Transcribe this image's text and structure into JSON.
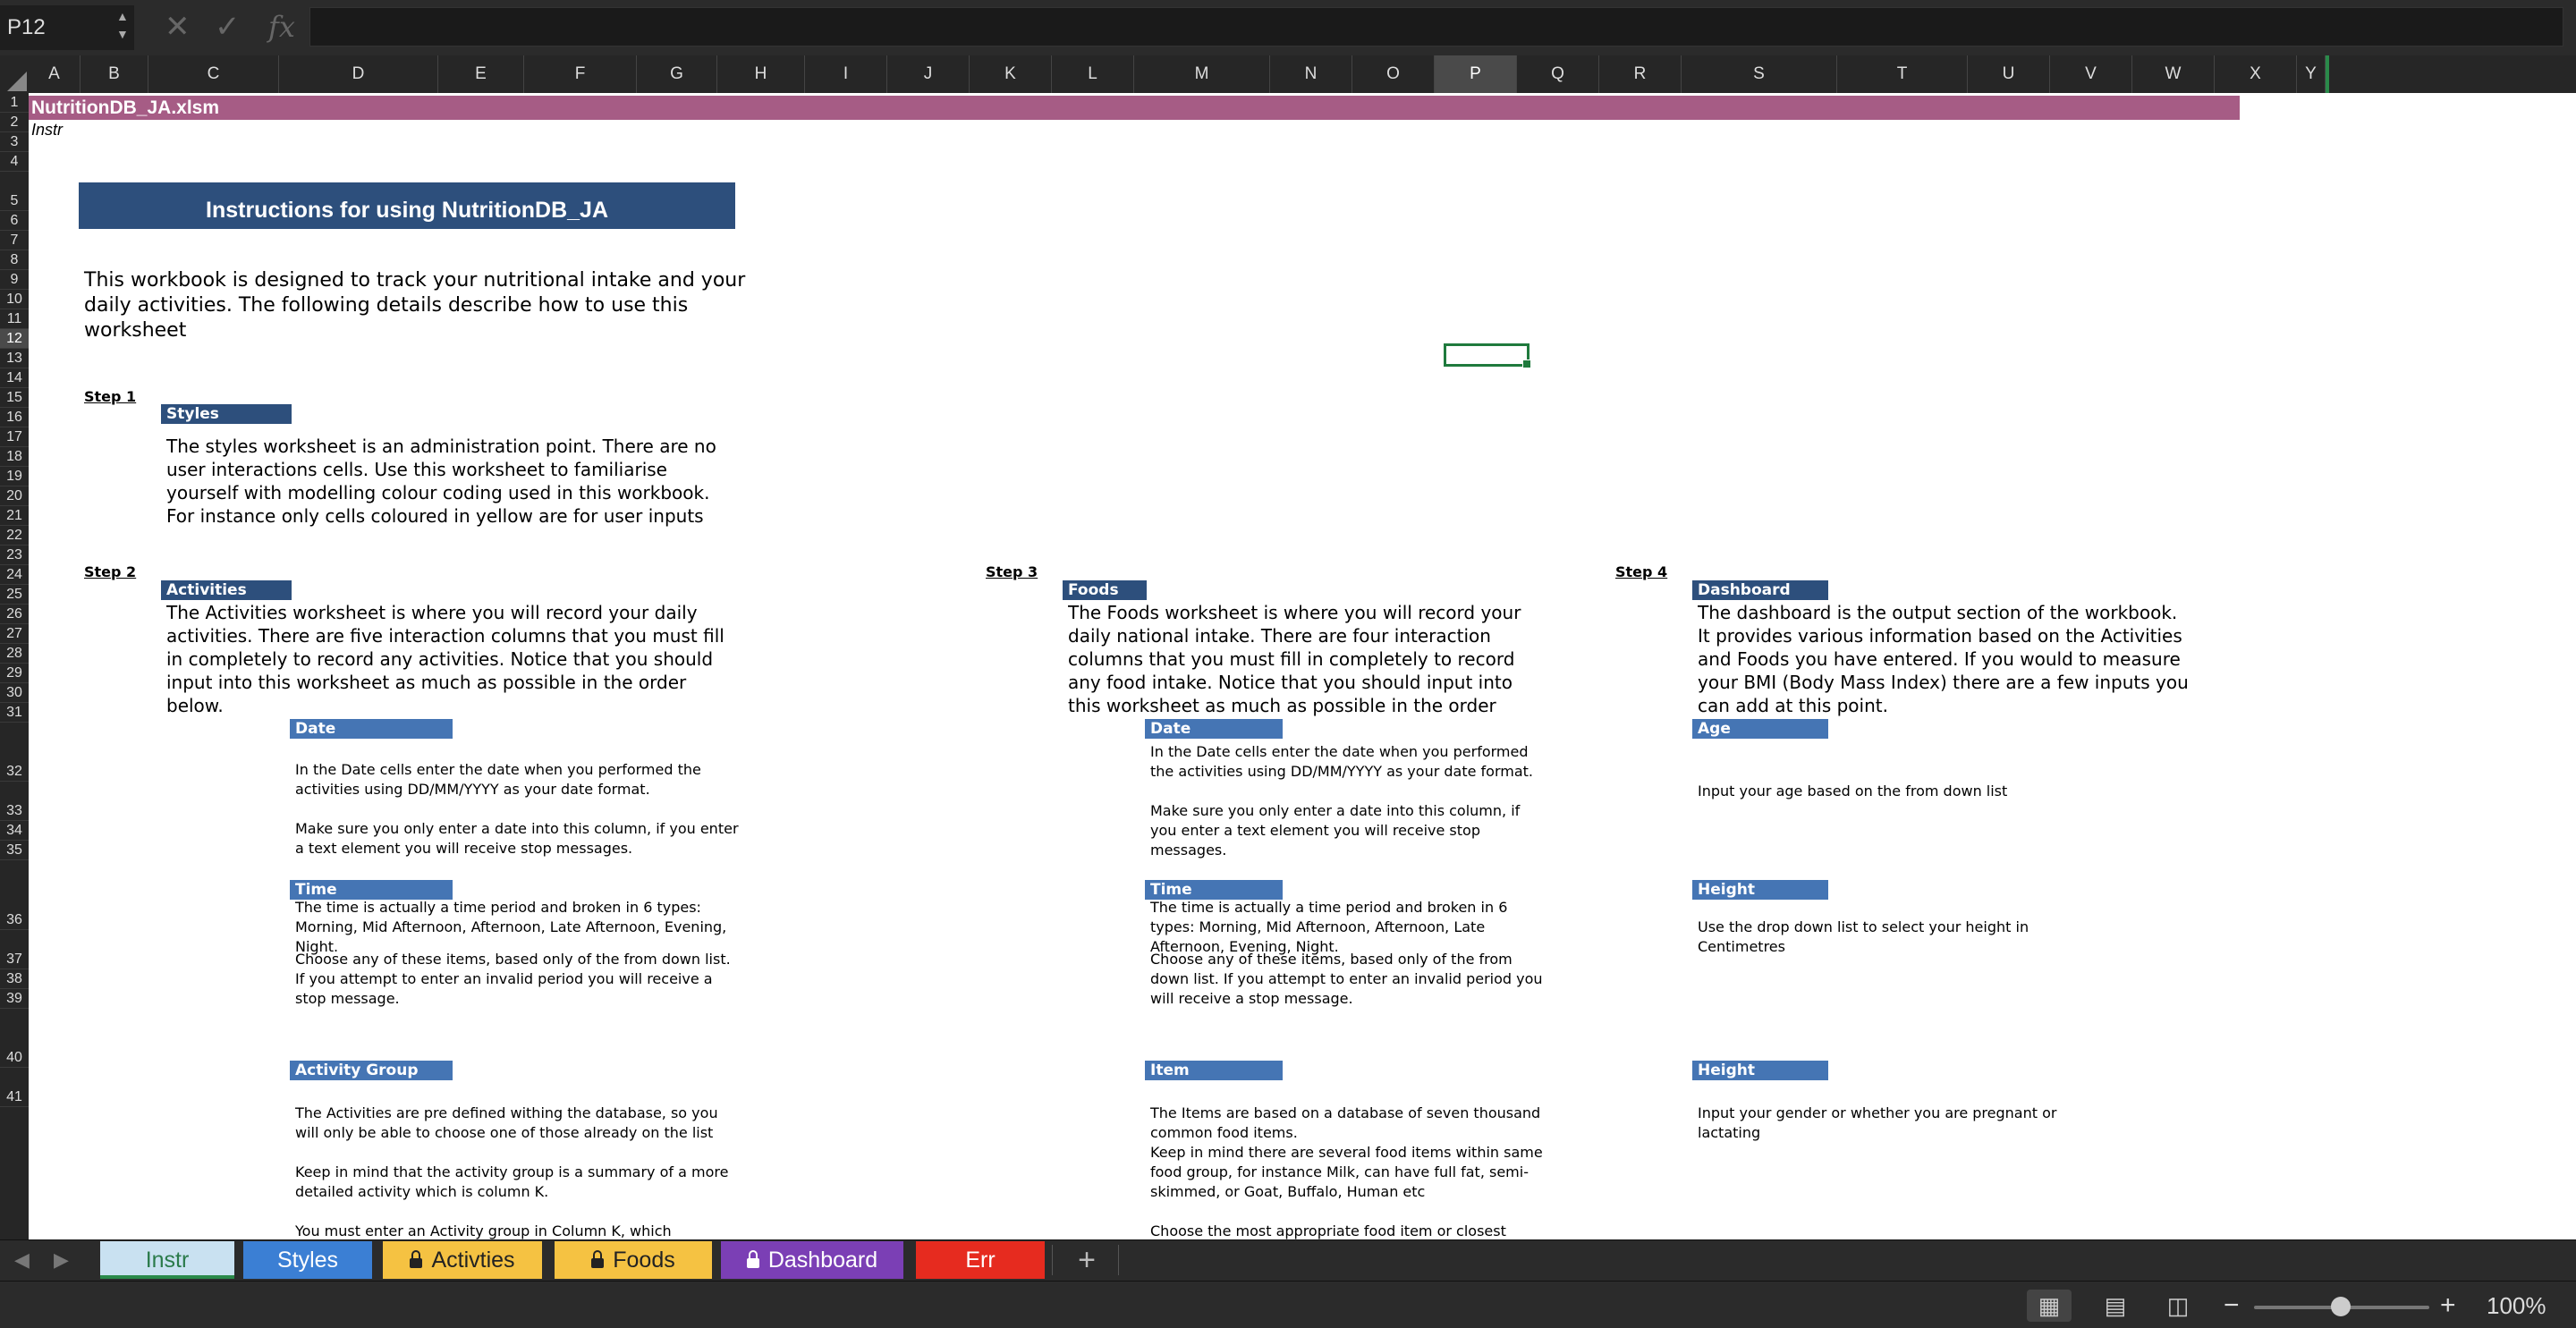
{
  "formula_bar": {
    "name_box": "P12",
    "cancel_icon": "✕",
    "enter_icon": "✓",
    "fx_label": "fx",
    "formula": ""
  },
  "columns": [
    "A",
    "B",
    "C",
    "D",
    "E",
    "F",
    "G",
    "H",
    "I",
    "J",
    "K",
    "L",
    "M",
    "N",
    "O",
    "P",
    "Q",
    "R",
    "S",
    "T",
    "U",
    "V",
    "W",
    "X",
    "Y"
  ],
  "selected_column": "P",
  "selected_row": "12",
  "rows": [
    "1",
    "2",
    "3",
    "4",
    "5",
    "6",
    "7",
    "8",
    "9",
    "10",
    "11",
    "12",
    "13",
    "14",
    "15",
    "16",
    "17",
    "18",
    "19",
    "20",
    "21",
    "22",
    "23",
    "24",
    "25",
    "26",
    "27",
    "28",
    "29",
    "30",
    "31",
    "32",
    "33",
    "34",
    "35",
    "36",
    "37",
    "38",
    "39",
    "40",
    "41"
  ],
  "sheet": {
    "title": "NutritionDB_JA.xlsm",
    "sheet_name": "Instr",
    "header": "Instructions for using NutritionDB_JA",
    "intro": "This workbook is designed to track your nutritional intake and your daily activities. The following details describe how to use this worksheet",
    "step1": {
      "label": "Step 1",
      "tag": "Styles",
      "text": "The styles worksheet is an administration point. There are no user interactions cells. Use this worksheet to familiarise yourself with modelling colour coding used in this workbook. For instance only cells coloured in yellow are for user inputs"
    },
    "step2": {
      "label": "Step 2",
      "tag": "Activities",
      "text": "The Activities worksheet is where you will record your daily activities. There are five interaction columns that you must fill in completely to record any activities. Notice that you should input into this worksheet as much as possible in the order below.",
      "date_tag": "Date",
      "date_text1": "In the Date cells enter the date when you performed the activities using DD/MM/YYYY as your date format.",
      "date_text2": "Make sure you only enter a date into this column, if you enter a text element you will receive stop messages.",
      "time_tag": "Time",
      "time_text1": "The time is actually a time period and broken in 6 types: Morning, Mid Afternoon, Afternoon, Late Afternoon, Evening, Night.",
      "time_text2": "Choose any of these items, based only of the from down list. If you attempt to enter an invalid period you will receive a stop message.",
      "group_tag": "Activity Group",
      "group_text1": "The Activities are pre defined withing the database, so you will only be able to choose one of those already on the list",
      "group_text2": "Keep in mind that the activity group is a summary of a more detailed activity which is column K.",
      "group_text3": "You must enter an Activity group in Column K, which"
    },
    "step3": {
      "label": "Step 3",
      "tag": "Foods",
      "text": "The Foods worksheet is where you will record your daily national intake. There are four interaction columns that you must fill in completely to record any food intake. Notice that you should input into this worksheet as much as possible in the order below.",
      "date_tag": "Date",
      "date_text1": "In the Date cells enter the date when you performed the activities using DD/MM/YYYY as your date format.",
      "date_text2": "Make sure you only enter a date into this column, if you enter a text element you will receive stop messages.",
      "time_tag": "Time",
      "time_text1": "The time is actually a time period and broken in 6 types: Morning, Mid Afternoon, Afternoon, Late Afternoon, Evening, Night.",
      "time_text2": "Choose any of these items, based only of the from down list. If you attempt to enter an invalid period you will receive a stop message.",
      "item_tag": "Item",
      "item_text1": "The Items are based on a database of seven thousand common food items.",
      "item_text2": "Keep in mind there are several food items within same  food group, for instance Milk, can have full fat, semi-skimmed, or Goat, Buffalo, Human etc",
      "item_text3": "Choose the most appropriate food item or closest"
    },
    "step4": {
      "label": "Step 4",
      "tag": "Dashboard",
      "text": "The dashboard is the output section of the workbook. It provides various information based on the Activities and Foods you have entered. If you would to measure your BMI (Body Mass Index) there are a few inputs you can add at this point.",
      "age_tag": "Age",
      "age_text": "Input your age based on the from down list",
      "height_tag": "Height",
      "height_text": "Use the drop down list to select your height in Centimetres",
      "gender_tag": "Height",
      "gender_text": "Input your gender or whether you are pregnant or lactating"
    }
  },
  "tabs": {
    "instr": "Instr",
    "styles": "Styles",
    "activities": "Activties",
    "foods": "Foods",
    "dashboard": "Dashboard",
    "err": "Err",
    "add": "+"
  },
  "status": {
    "zoom": "100%",
    "zoom_level_percent": 100
  }
}
